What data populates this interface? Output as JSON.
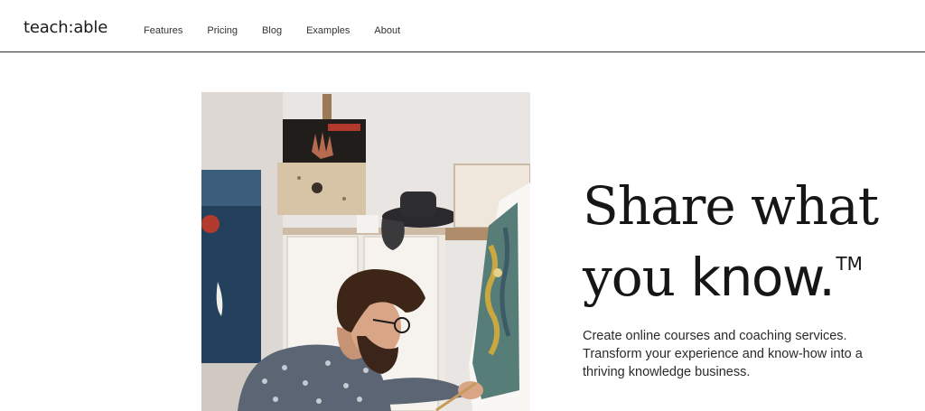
{
  "header": {
    "logo": "teach:able",
    "nav": [
      {
        "label": "Features"
      },
      {
        "label": "Pricing"
      },
      {
        "label": "Blog"
      },
      {
        "label": "Examples"
      },
      {
        "label": "About"
      }
    ]
  },
  "hero": {
    "headline_line1": "Share what",
    "headline_line2_plain": "you ",
    "headline_line2_bold": "know.",
    "trademark": "TM",
    "subtext": "Create online courses and coaching services. Transform your experience and know-how into a thriving knowledge business.",
    "image_subject": "man painting on canvas in studio"
  },
  "colors": {
    "text": "#161616",
    "border": "#2b2b2b",
    "background": "#ffffff"
  }
}
